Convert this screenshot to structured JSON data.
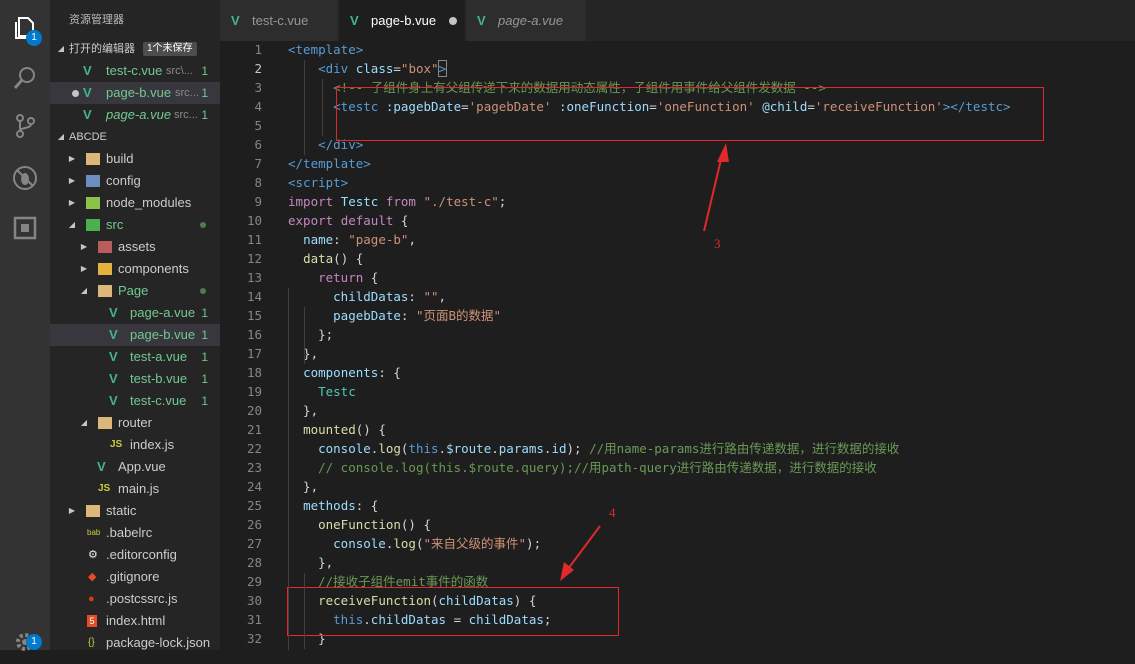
{
  "activity_bar": {
    "explorer_badge": "1",
    "settings_badge": "1",
    "icons": [
      "files-icon",
      "search-icon",
      "source-control-icon",
      "debug-icon",
      "extensions-icon",
      "settings-icon"
    ]
  },
  "sidebar": {
    "title": "资源管理器",
    "open_editors": {
      "label": "打开的编辑器",
      "unsaved_badge": "1个未保存",
      "items": [
        {
          "name": "test-c.vue",
          "path": "src\\...",
          "count": "1"
        },
        {
          "name": "page-b.vue",
          "path": "src...",
          "count": "1"
        },
        {
          "name": "page-a.vue",
          "path": "src...",
          "count": "1"
        }
      ]
    },
    "project": {
      "label": "ABCDE",
      "items": [
        {
          "name": "build"
        },
        {
          "name": "config"
        },
        {
          "name": "node_modules"
        },
        {
          "name": "src"
        },
        {
          "name": "assets"
        },
        {
          "name": "components"
        },
        {
          "name": "Page"
        },
        {
          "name": "page-a.vue",
          "count": "1"
        },
        {
          "name": "page-b.vue",
          "count": "1"
        },
        {
          "name": "test-a.vue",
          "count": "1"
        },
        {
          "name": "test-b.vue",
          "count": "1"
        },
        {
          "name": "test-c.vue",
          "count": "1"
        },
        {
          "name": "router"
        },
        {
          "name": "index.js"
        },
        {
          "name": "App.vue"
        },
        {
          "name": "main.js"
        },
        {
          "name": "static"
        },
        {
          "name": ".babelrc"
        },
        {
          "name": ".editorconfig"
        },
        {
          "name": ".gitignore"
        },
        {
          "name": ".postcssrc.js"
        },
        {
          "name": "index.html"
        },
        {
          "name": "package-lock.json"
        }
      ]
    }
  },
  "tabs": [
    {
      "label": "test-c.vue"
    },
    {
      "label": "page-b.vue",
      "active": true,
      "dirty": true
    },
    {
      "label": "page-a.vue"
    }
  ],
  "editor": {
    "current_line": 2,
    "lines": [
      [
        [
          "t",
          "<template>"
        ]
      ],
      [
        [
          "p",
          "    "
        ],
        [
          "t",
          "<div"
        ],
        [
          "p",
          " "
        ],
        [
          "a",
          "class"
        ],
        [
          "p",
          "="
        ],
        [
          "s",
          "\"box\""
        ],
        [
          "tb",
          ">"
        ]
      ],
      [
        [
          "p",
          "      "
        ],
        [
          "c",
          "<!-- 子组件身上有父组传递下来的数据用动态属性，子组件用事件给父组件发数据 -->"
        ]
      ],
      [
        [
          "p",
          "      "
        ],
        [
          "t",
          "<testc"
        ],
        [
          "p",
          " "
        ],
        [
          "a",
          ":pagebDate"
        ],
        [
          "p",
          "="
        ],
        [
          "s",
          "'pagebDate'"
        ],
        [
          "p",
          " "
        ],
        [
          "a",
          ":oneFunction"
        ],
        [
          "p",
          "="
        ],
        [
          "s",
          "'oneFunction'"
        ],
        [
          "p",
          " "
        ],
        [
          "a",
          "@child"
        ],
        [
          "p",
          "="
        ],
        [
          "s",
          "'receiveFunction'"
        ],
        [
          "t",
          "></testc>"
        ]
      ],
      [
        [
          "p",
          ""
        ]
      ],
      [
        [
          "p",
          "    "
        ],
        [
          "t",
          "</div>"
        ]
      ],
      [
        [
          "t",
          "</template>"
        ]
      ],
      [
        [
          "t",
          "<script>"
        ]
      ],
      [
        [
          "k",
          "import"
        ],
        [
          "p",
          " "
        ],
        [
          "v",
          "Testc"
        ],
        [
          "p",
          " "
        ],
        [
          "k",
          "from"
        ],
        [
          "p",
          " "
        ],
        [
          "s",
          "\"./test-c\""
        ],
        [
          "p",
          ";"
        ]
      ],
      [
        [
          "k",
          "export"
        ],
        [
          "p",
          " "
        ],
        [
          "k",
          "default"
        ],
        [
          "p",
          " {"
        ]
      ],
      [
        [
          "p",
          "  "
        ],
        [
          "v",
          "name"
        ],
        [
          "p",
          ": "
        ],
        [
          "s",
          "\"page-b\""
        ],
        [
          "p",
          ","
        ]
      ],
      [
        [
          "p",
          "  "
        ],
        [
          "f",
          "data"
        ],
        [
          "p",
          "() {"
        ]
      ],
      [
        [
          "p",
          "    "
        ],
        [
          "k",
          "return"
        ],
        [
          "p",
          " {"
        ]
      ],
      [
        [
          "p",
          "      "
        ],
        [
          "v",
          "childDatas"
        ],
        [
          "p",
          ": "
        ],
        [
          "s",
          "\"\""
        ],
        [
          "p",
          ","
        ]
      ],
      [
        [
          "p",
          "      "
        ],
        [
          "v",
          "pagebDate"
        ],
        [
          "p",
          ": "
        ],
        [
          "s",
          "\"页面B的数据\""
        ]
      ],
      [
        [
          "p",
          "    };"
        ]
      ],
      [
        [
          "p",
          "  },"
        ]
      ],
      [
        [
          "p",
          "  "
        ],
        [
          "v",
          "components"
        ],
        [
          "p",
          ": {"
        ]
      ],
      [
        [
          "p",
          "    "
        ],
        [
          "cl",
          "Testc"
        ]
      ],
      [
        [
          "p",
          "  },"
        ]
      ],
      [
        [
          "p",
          "  "
        ],
        [
          "f",
          "mounted"
        ],
        [
          "p",
          "() {"
        ]
      ],
      [
        [
          "p",
          "    "
        ],
        [
          "v",
          "console"
        ],
        [
          "p",
          "."
        ],
        [
          "f",
          "log"
        ],
        [
          "p",
          "("
        ],
        [
          "k2",
          "this"
        ],
        [
          "p",
          "."
        ],
        [
          "v",
          "$route"
        ],
        [
          "p",
          "."
        ],
        [
          "v",
          "params"
        ],
        [
          "p",
          "."
        ],
        [
          "v",
          "id"
        ],
        [
          "p",
          "); "
        ],
        [
          "c",
          "//用name-params进行路由传递数据，进行数据的接收"
        ]
      ],
      [
        [
          "p",
          "    "
        ],
        [
          "c",
          "// console.log(this.$route.query);//用path-query进行路由传递数据，进行数据的接收"
        ]
      ],
      [
        [
          "p",
          "  },"
        ]
      ],
      [
        [
          "p",
          "  "
        ],
        [
          "v",
          "methods"
        ],
        [
          "p",
          ": {"
        ]
      ],
      [
        [
          "p",
          "    "
        ],
        [
          "f",
          "oneFunction"
        ],
        [
          "p",
          "() {"
        ]
      ],
      [
        [
          "p",
          "      "
        ],
        [
          "v",
          "console"
        ],
        [
          "p",
          "."
        ],
        [
          "f",
          "log"
        ],
        [
          "p",
          "("
        ],
        [
          "s",
          "\"来自父级的事件\""
        ],
        [
          "p",
          ");"
        ]
      ],
      [
        [
          "p",
          "    },"
        ]
      ],
      [
        [
          "p",
          "    "
        ],
        [
          "c",
          "//接收子组件emit事件的函数"
        ]
      ],
      [
        [
          "p",
          "    "
        ],
        [
          "f",
          "receiveFunction"
        ],
        [
          "p",
          "("
        ],
        [
          "v",
          "childDatas"
        ],
        [
          "p",
          ") {"
        ]
      ],
      [
        [
          "p",
          "      "
        ],
        [
          "k2",
          "this"
        ],
        [
          "p",
          "."
        ],
        [
          "v",
          "childDatas"
        ],
        [
          "p",
          " = "
        ],
        [
          "v",
          "childDatas"
        ],
        [
          "p",
          ";"
        ]
      ],
      [
        [
          "p",
          "    }"
        ]
      ]
    ]
  },
  "annotations": {
    "label_3": "3",
    "label_4": "4"
  },
  "colors": {
    "red_annotation": "#e0292a",
    "vue_green": "#41b883",
    "accent": "#007acc"
  }
}
